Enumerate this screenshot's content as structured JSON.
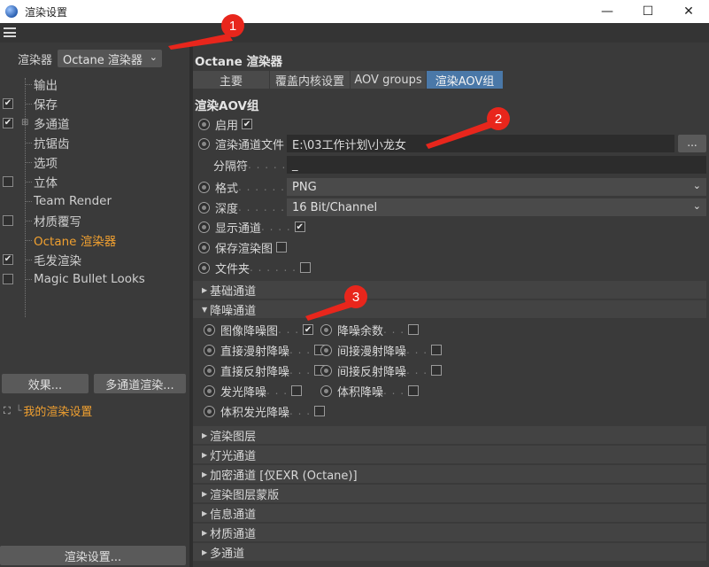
{
  "window": {
    "title": "渲染设置",
    "minimize": "—",
    "maximize": "☐",
    "close": "✕"
  },
  "left": {
    "renderer_label": "渲染器",
    "renderer_value": "Octane 渲染器",
    "tree": [
      {
        "label": "输出",
        "checkbox": null,
        "active": false
      },
      {
        "label": "保存",
        "checkbox": true,
        "active": false
      },
      {
        "label": "多通道",
        "checkbox": true,
        "active": false,
        "expander": "⊞"
      },
      {
        "label": "抗锯齿",
        "checkbox": null,
        "active": false
      },
      {
        "label": "选项",
        "checkbox": null,
        "active": false
      },
      {
        "label": "立体",
        "checkbox": false,
        "active": false
      },
      {
        "label": "Team Render",
        "checkbox": null,
        "active": false
      },
      {
        "label": "材质覆写",
        "checkbox": false,
        "active": false
      },
      {
        "label": "Octane 渲染器",
        "checkbox": null,
        "active": true
      },
      {
        "label": "毛发渲染",
        "checkbox": true,
        "active": false
      },
      {
        "label": "Magic Bullet Looks",
        "checkbox": false,
        "active": false
      }
    ],
    "effects_button": "效果...",
    "multipass_button": "多通道渲染...",
    "preset_label": "我的渲染设置",
    "render_settings_button": "渲染设置..."
  },
  "right": {
    "title": "Octane 渲染器",
    "tabs": [
      "主要",
      "覆盖内核设置",
      "AOV groups",
      "渲染AOV组"
    ],
    "selected_tab": 3,
    "section_title": "渲染AOV组",
    "enable_label": "启用",
    "enable_checked": true,
    "file_label": "渲染通道文件",
    "file_value": "E:\\03工作计划\\小龙女",
    "browse_button": "...",
    "separator_label": "分隔符",
    "separator_value": "_",
    "format_label": "格式",
    "format_value": "PNG",
    "depth_label": "深度",
    "depth_value": "16 Bit/Channel",
    "show_channel_label": "显示通道",
    "show_channel_checked": true,
    "save_render_label": "保存渲染图",
    "save_render_checked": false,
    "folder_label": "文件夹",
    "folder_checked": false,
    "groups_top": [
      {
        "label": "基础通道",
        "expanded": false
      },
      {
        "label": "降噪通道",
        "expanded": true
      }
    ],
    "denoise": [
      {
        "label": "图像降噪图",
        "checked": true
      },
      {
        "label": "降噪余数",
        "checked": false
      },
      {
        "label": "直接漫射降噪",
        "checked": false
      },
      {
        "label": "间接漫射降噪",
        "checked": false
      },
      {
        "label": "直接反射降噪",
        "checked": false
      },
      {
        "label": "间接反射降噪",
        "checked": false
      },
      {
        "label": "发光降噪",
        "checked": false
      },
      {
        "label": "体积降噪",
        "checked": false
      },
      {
        "label": "体积发光降噪",
        "checked": false
      }
    ],
    "groups_bottom": [
      {
        "label": "渲染图层"
      },
      {
        "label": "灯光通道"
      },
      {
        "label": "加密通道 [仅EXR (Octane)]"
      },
      {
        "label": "渲染图层蒙版"
      },
      {
        "label": "信息通道"
      },
      {
        "label": "材质通道"
      },
      {
        "label": "多通道"
      }
    ]
  },
  "annotations": [
    "1",
    "2",
    "3"
  ],
  "colors": {
    "accent_orange": "#f0a030",
    "selected_tab": "#4a78a8",
    "annotation_red": "#e8261c"
  }
}
